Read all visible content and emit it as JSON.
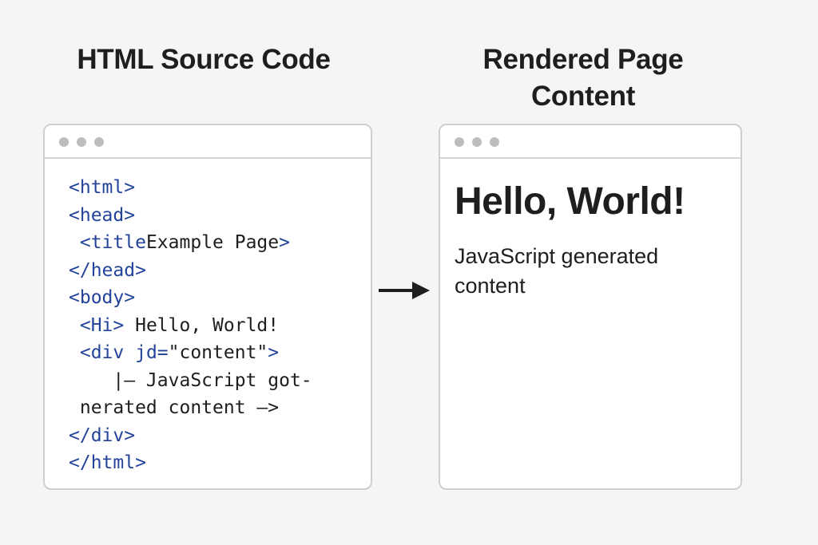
{
  "left_panel": {
    "heading": "HTML Source Code",
    "code_lines": [
      [
        {
          "t": "tag",
          "s": "<html>"
        }
      ],
      [
        {
          "t": "tag",
          "s": "<head>"
        }
      ],
      [
        {
          "t": "txt",
          "s": " "
        },
        {
          "t": "tag",
          "s": "<title"
        },
        {
          "t": "txt",
          "s": "Example Page"
        },
        {
          "t": "tag",
          "s": ">"
        }
      ],
      [
        {
          "t": "tag",
          "s": "</head>"
        }
      ],
      [
        {
          "t": "tag",
          "s": "<body>"
        }
      ],
      [
        {
          "t": "txt",
          "s": " "
        },
        {
          "t": "tag",
          "s": "<Hi>"
        },
        {
          "t": "txt",
          "s": " Hello, World!"
        }
      ],
      [
        {
          "t": "txt",
          "s": " "
        },
        {
          "t": "tag",
          "s": "<div jd="
        },
        {
          "t": "txt",
          "s": "\"content\""
        },
        {
          "t": "tag",
          "s": ">"
        }
      ],
      [
        {
          "t": "txt",
          "s": "    |– JavaScript got-"
        }
      ],
      [
        {
          "t": "txt",
          "s": " nerated content –>"
        }
      ],
      [
        {
          "t": "tag",
          "s": "</div>"
        }
      ],
      [
        {
          "t": "tag",
          "s": "</html>"
        }
      ]
    ]
  },
  "right_panel": {
    "heading_line1": "Rendered Page",
    "heading_line2": "Content",
    "rendered_heading": "Hello, World!",
    "rendered_text": "JavaScript generated content"
  },
  "colors": {
    "background": "#f5f5f5",
    "tag": "#23449a",
    "text": "#1e1e1e",
    "window_border": "#cfcfcf",
    "window_dots": "#bdbdbd"
  },
  "icons": {
    "window_controls": "window-dots-icon",
    "flow": "arrow-right-icon"
  }
}
